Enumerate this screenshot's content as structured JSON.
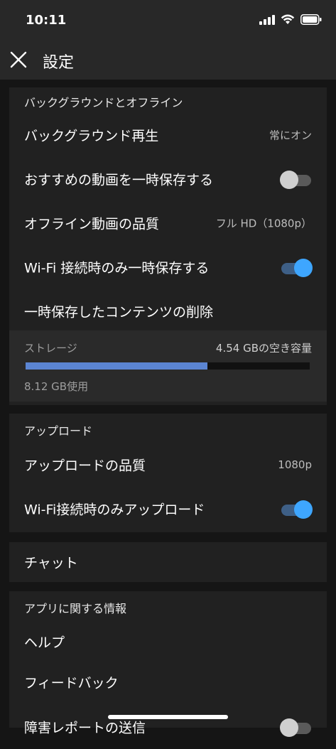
{
  "status_bar": {
    "time": "10:11"
  },
  "header": {
    "title": "設定"
  },
  "sections": {
    "background_offline": {
      "header": "バックグラウンドとオフライン",
      "rows": [
        {
          "label": "バックグラウンド再生",
          "value": "常にオン"
        },
        {
          "label": "おすすめの動画を一時保存する",
          "toggle": false
        },
        {
          "label": "オフライン動画の品質",
          "value": "フル HD（1080p）"
        },
        {
          "label": "Wi-Fi 接続時のみ一時保存する",
          "toggle": true
        },
        {
          "label": "一時保存したコンテンツの削除"
        }
      ],
      "storage": {
        "label": "ストレージ",
        "free": "4.54 GBの空き容量",
        "used": "8.12 GB使用",
        "used_fraction": 0.64
      }
    },
    "upload": {
      "header": "アップロード",
      "rows": [
        {
          "label": "アップロードの品質",
          "value": "1080p"
        },
        {
          "label": "Wi-Fi接続時のみアップロード",
          "toggle": true
        }
      ]
    },
    "chat": {
      "label": "チャット"
    },
    "about": {
      "header": "アプリに関する情報",
      "rows": [
        {
          "label": "ヘルプ"
        },
        {
          "label": "フィードバック"
        },
        {
          "label": "障害レポートの送信",
          "toggle": false
        }
      ]
    }
  },
  "colors": {
    "background": "#151515",
    "card": "#212121",
    "accent": "#3ea6ff",
    "storage_fill": "#5b85d3"
  }
}
